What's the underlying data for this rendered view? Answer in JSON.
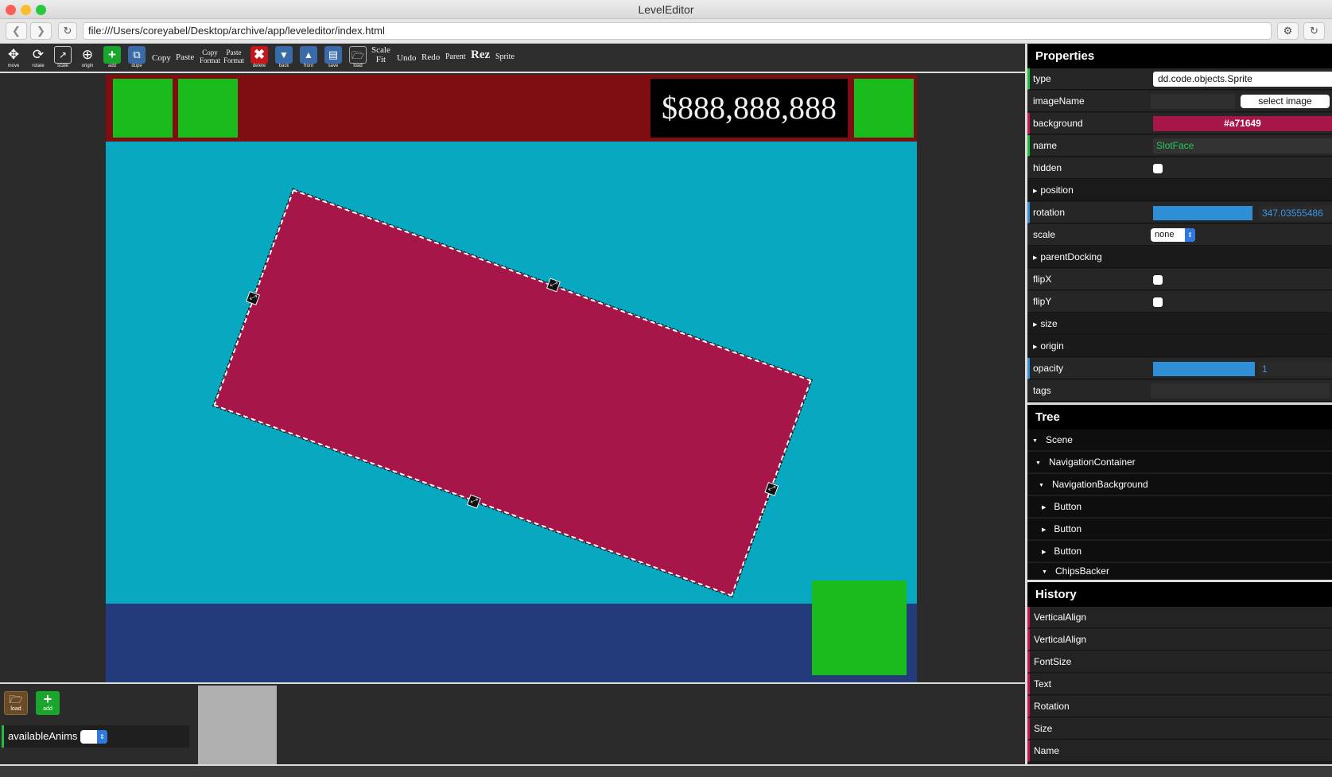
{
  "window": {
    "title": "LevelEditor",
    "url": "file:///Users/coreyabel/Desktop/archive/app/leveleditor/index.html"
  },
  "toolbar": {
    "icon_tools": [
      {
        "name": "move",
        "label": "move",
        "icon": "move-arrows-icon"
      },
      {
        "name": "rotate",
        "label": "rotate",
        "icon": "rotate-icon"
      },
      {
        "name": "scale",
        "label": "scale",
        "icon": "scale-icon"
      },
      {
        "name": "origin",
        "label": "origin",
        "icon": "origin-crosshair-icon"
      },
      {
        "name": "add",
        "label": "add",
        "icon": "plus-icon"
      },
      {
        "name": "dupe",
        "label": "dupe",
        "icon": "duplicate-icon"
      },
      {
        "name": "delete",
        "label": "delete",
        "icon": "x-icon"
      },
      {
        "name": "back",
        "label": "back",
        "icon": "send-back-icon"
      },
      {
        "name": "front",
        "label": "front",
        "icon": "bring-front-icon"
      },
      {
        "name": "save",
        "label": "save",
        "icon": "save-icon"
      },
      {
        "name": "load",
        "label": "load",
        "icon": "folder-icon"
      }
    ],
    "copy": "Copy",
    "paste": "Paste",
    "copy_format_1": "Copy",
    "copy_format_2": "Format",
    "paste_format_1": "Paste",
    "paste_format_2": "Format",
    "scale_fit_1": "Scale",
    "scale_fit_2": "Fit",
    "undo": "Undo",
    "redo": "Redo",
    "parent": "Parent",
    "rez": "Rez",
    "sprite": "Sprite"
  },
  "stage": {
    "money": "$888,888,888",
    "colors": {
      "background": "#07a8c0",
      "top_bar": "#7e0e0f",
      "bottom_bar": "#233b7a",
      "green_box": "#1abb1c",
      "selected_sprite": "#a71649"
    }
  },
  "bottom_panel": {
    "load_label": "load",
    "add_label": "add",
    "available_anims_label": "availableAnims"
  },
  "properties": {
    "title": "Properties",
    "type_label": "type",
    "type_value": "dd.code.objects.Sprite",
    "imageName_label": "imageName",
    "select_image": "select image",
    "background_label": "background",
    "background_value": "#a71649",
    "name_label": "name",
    "name_value": "SlotFace",
    "hidden_label": "hidden",
    "position_label": "position",
    "rotation_label": "rotation",
    "rotation_value": "347.03555486",
    "scale_label": "scale",
    "scale_value": "none",
    "parentDocking_label": "parentDocking",
    "flipX_label": "flipX",
    "flipY_label": "flipY",
    "size_label": "size",
    "origin_label": "origin",
    "opacity_label": "opacity",
    "opacity_value": "1",
    "tags_label": "tags"
  },
  "tree": {
    "title": "Tree",
    "nodes": [
      {
        "label": "Scene",
        "expanded": true
      },
      {
        "label": "NavigationContainer",
        "expanded": true
      },
      {
        "label": "NavigationBackground",
        "expanded": true
      },
      {
        "label": "Button",
        "expanded": false
      },
      {
        "label": "Button",
        "expanded": false
      },
      {
        "label": "Button",
        "expanded": false
      },
      {
        "label": "ChipsBacker",
        "expanded": true
      }
    ]
  },
  "history": {
    "title": "History",
    "items": [
      "VerticalAlign",
      "VerticalAlign",
      "FontSize",
      "Text",
      "Rotation",
      "Size",
      "Name"
    ]
  }
}
